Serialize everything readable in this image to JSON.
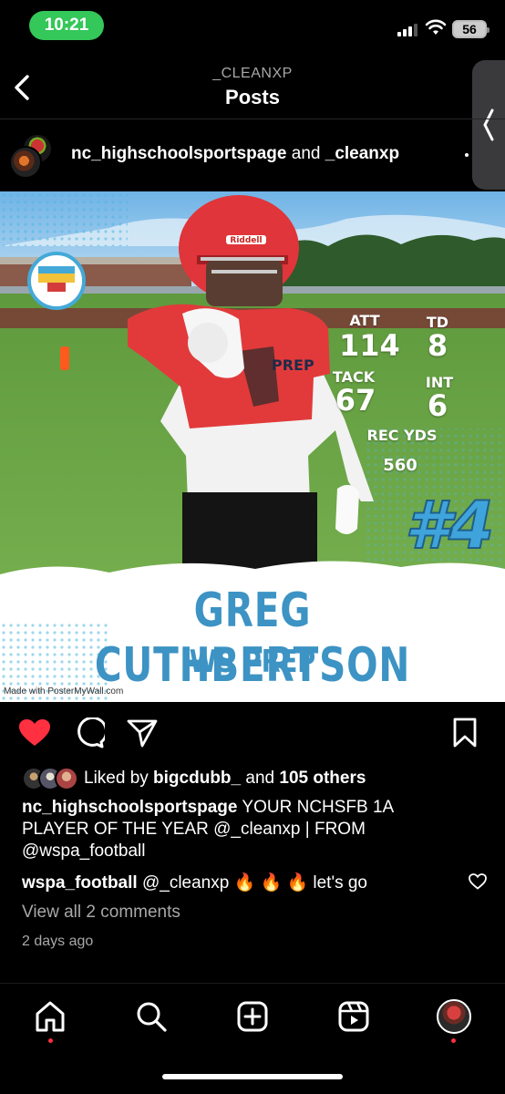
{
  "status_bar": {
    "time": "10:21",
    "battery": "56",
    "time_pill_color": "#34c759"
  },
  "header": {
    "subtitle": "_CLEANXP",
    "title": "Posts"
  },
  "post": {
    "author_primary": "nc_highschoolsportspage",
    "author_joiner": " and ",
    "author_secondary": "_cleanxp",
    "image": {
      "stats": {
        "att_label": "ATT",
        "att_value": "114",
        "td_label": "TD",
        "td_value": "8",
        "tack_label": "TACK",
        "tack_value": "67",
        "int_label": "INT",
        "int_value": "6",
        "rec_yds_label": "REC YDS",
        "rec_yds_value": "560"
      },
      "helmet_brand": "Riddell",
      "jersey_text": "PREP",
      "jersey_number": "#4",
      "player_name": "GREG CUTHBERTSON",
      "team": "WS PREP",
      "watermark": "Made with PosterMyWall.com",
      "accent_color": "#3c93c4"
    },
    "likes": {
      "prefix": "Liked by ",
      "user": "bigcdubb_",
      "joiner": " and ",
      "others": "105 others"
    },
    "caption": {
      "user": "nc_highschoolsportspage",
      "text": " YOUR NCHSFB 1A PLAYER OF THE YEAR @_cleanxp | FROM @wspa_football"
    },
    "comment": {
      "user": "wspa_football",
      "text": " @_cleanxp 🔥 🔥 🔥  let's go"
    },
    "view_comments": "View all 2 comments",
    "timestamp": "2 days ago",
    "like_color": "#ff3040"
  },
  "icons": {
    "back": "chevron-left-icon",
    "like": "heart-filled-icon",
    "comment": "speech-bubble-icon",
    "share": "paper-plane-icon",
    "save": "bookmark-icon",
    "home": "home-icon",
    "search": "search-icon",
    "create": "plus-square-icon",
    "reels": "reels-icon",
    "profile": "profile-avatar"
  }
}
